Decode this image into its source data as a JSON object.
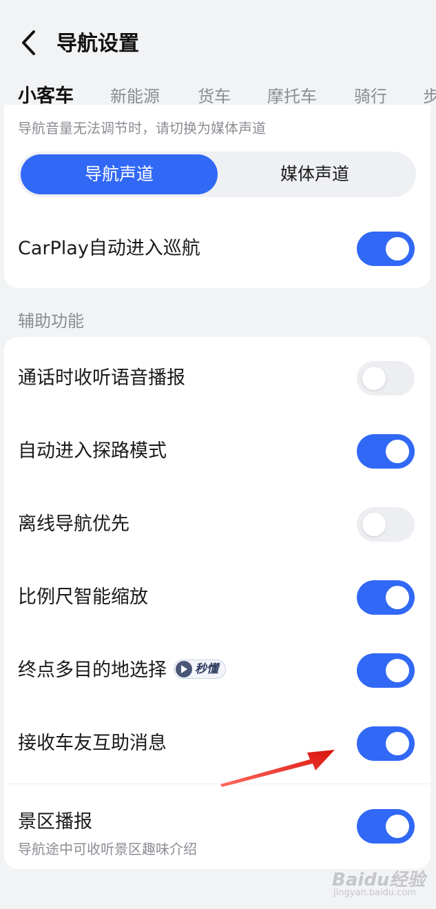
{
  "header": {
    "title": "导航设置"
  },
  "tabs": [
    {
      "label": "小客车"
    },
    {
      "label": "新能源"
    },
    {
      "label": "货车"
    },
    {
      "label": "摩托车"
    },
    {
      "label": "骑行"
    },
    {
      "label": "步"
    }
  ],
  "audio": {
    "hint": "导航音量无法调节时，请切换为媒体声道",
    "channel_options": [
      "导航声道",
      "媒体声道"
    ],
    "selected_channel": "导航声道",
    "carplay_label": "CarPlay自动进入巡航",
    "carplay_on": true
  },
  "assist": {
    "section_title": "辅助功能",
    "items": [
      {
        "label": "通话时收听语音播报",
        "on": false
      },
      {
        "label": "自动进入探路模式",
        "on": true
      },
      {
        "label": "离线导航优先",
        "on": false
      },
      {
        "label": "比例尺智能缩放",
        "on": true
      },
      {
        "label": "终点多目的地选择",
        "on": true,
        "badge": "秒懂"
      },
      {
        "label": "接收车友互助消息",
        "on": true
      },
      {
        "label": "景区播报",
        "sublabel": "导航途中可收听景区趣味介绍",
        "on": true
      }
    ]
  },
  "colors": {
    "accent": "#3168f5",
    "annotation_arrow": "#e8261d"
  },
  "watermark": {
    "main": "Baidu经验",
    "sub": "jingyan.baidu.com"
  }
}
